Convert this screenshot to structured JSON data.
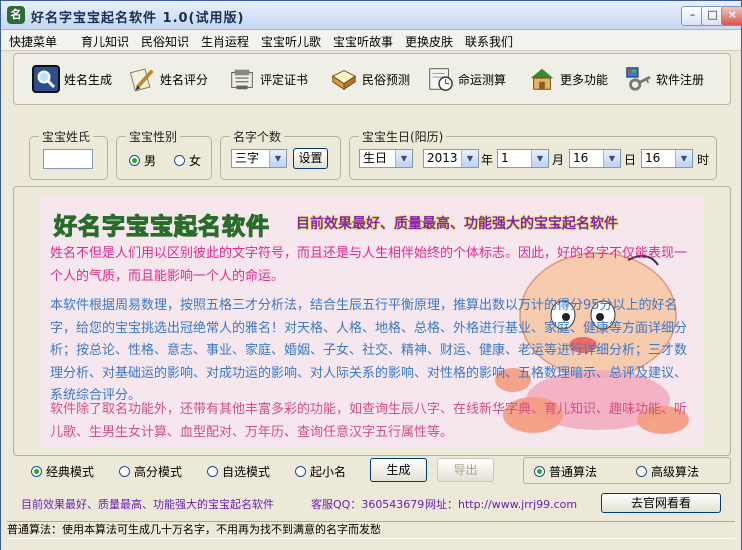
{
  "window": {
    "title": "好名字宝宝起名软件 1.0(试用版)",
    "icon_text": "名",
    "min_symbol": "–",
    "max_symbol": "□",
    "close_symbol": "×"
  },
  "menu": [
    "快捷菜单",
    "育儿知识",
    "民俗知识",
    "生肖运程",
    "宝宝听儿歌",
    "宝宝听故事",
    "更换皮肤",
    "联系我们"
  ],
  "toolbar": [
    {
      "label": "姓名生成",
      "icon": "search-icon"
    },
    {
      "label": "姓名评分",
      "icon": "edit-document-icon"
    },
    {
      "label": "评定证书",
      "icon": "certificate-icon"
    },
    {
      "label": "民俗预测",
      "icon": "book-icon"
    },
    {
      "label": "命运测算",
      "icon": "clock-icon"
    },
    {
      "label": "更多功能",
      "icon": "house-icon"
    },
    {
      "label": "软件注册",
      "icon": "key-icon"
    }
  ],
  "form": {
    "surname": {
      "label": "宝宝姓氏",
      "value": ""
    },
    "gender": {
      "label": "宝宝性别",
      "options": [
        "男",
        "女"
      ],
      "selected": "男"
    },
    "name_count": {
      "label": "名字个数",
      "value": "三字",
      "settings_label": "设置"
    },
    "birthday": {
      "label": "宝宝生日(阳历)",
      "calendar": "生日",
      "year": "2013",
      "year_unit": "年",
      "month": "1",
      "month_unit": "月",
      "day": "16",
      "day_unit": "日",
      "hour": "16",
      "hour_unit": "时"
    }
  },
  "banner": {
    "title": "好名字宝宝起名软件",
    "slogan": "目前效果最好、质量最高、功能强大的宝宝起名软件",
    "para1": "姓名不但是人们用以区别彼此的文字符号，而且还是与人生相伴始终的个体标志。因此，好的名字不仅能表现一个人的气质，而且能影响一个人的命运。",
    "para2": "本软件根据周易数理，按照五格三才分析法，结合生辰五行平衡原理，推算出数以万计的得分95分以上的好名字，给您的宝宝挑选出冠绝常人的雅名！对天格、人格、地格、总格、外格进行基业、家庭、健康等方面详细分析；按总论、性格、意志、事业、家庭、婚姻、子女、社交、精神、财运、健康、老运等进行详细分析；三才数理分析、对基础运的影响、对成功运的影响、对人际关系的影响、对性格的影响、五格数理暗示、总评及建议、系统综合评分。",
    "para3": "软件除了取名功能外，还带有其他丰富多彩的功能，如查询生辰八字、在线新华字典、育儿知识、趣味功能、听儿歌、生男生女计算、血型配对、万年历、查询任意汉字五行属性等。"
  },
  "modes": {
    "options": [
      "经典模式",
      "高分模式",
      "自选模式",
      "起小名"
    ],
    "selected": "经典模式",
    "generate_label": "生成",
    "export_label": "导出"
  },
  "algorithms": {
    "options": [
      "普通算法",
      "高级算法"
    ],
    "selected": "普通算法"
  },
  "info": {
    "slogan": "目前效果最好、质量最高、功能强大的宝宝起名软件",
    "qq": "客服QQ：360543679",
    "website": "网址：http://www.jrrj99.com",
    "visit_label": "去官网看看"
  },
  "status": {
    "text": "普通算法：使用本算法可生成几十万名字，不用再为找不到满意的名字而发愁"
  }
}
